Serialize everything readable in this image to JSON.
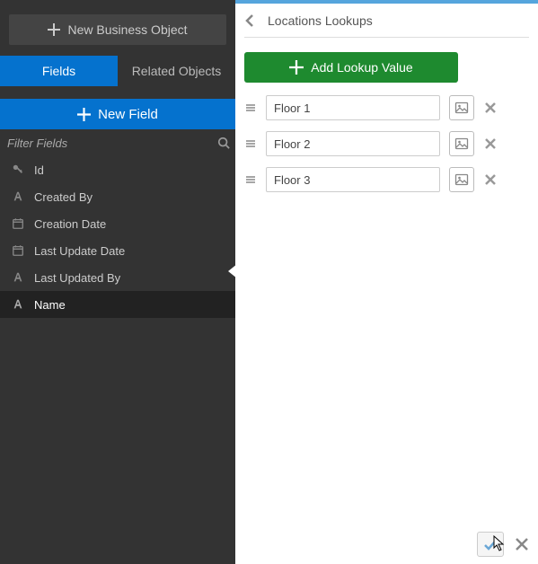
{
  "left": {
    "new_bo_label": "New Business Object",
    "tabs": {
      "fields": "Fields",
      "related": "Related Objects",
      "active": "fields"
    },
    "new_field_label": "New Field",
    "filter_placeholder": "Filter Fields",
    "fields": [
      {
        "icon": "key",
        "label": "Id",
        "selected": false
      },
      {
        "icon": "text",
        "label": "Created By",
        "selected": false
      },
      {
        "icon": "date",
        "label": "Creation Date",
        "selected": false
      },
      {
        "icon": "date",
        "label": "Last Update Date",
        "selected": false
      },
      {
        "icon": "text",
        "label": "Last Updated By",
        "selected": false
      },
      {
        "icon": "text",
        "label": "Name",
        "selected": true
      }
    ]
  },
  "right": {
    "title": "Locations Lookups",
    "add_label": "Add Lookup Value",
    "lookups": [
      {
        "value": "Floor 1"
      },
      {
        "value": "Floor 2"
      },
      {
        "value": "Floor 3"
      }
    ]
  }
}
